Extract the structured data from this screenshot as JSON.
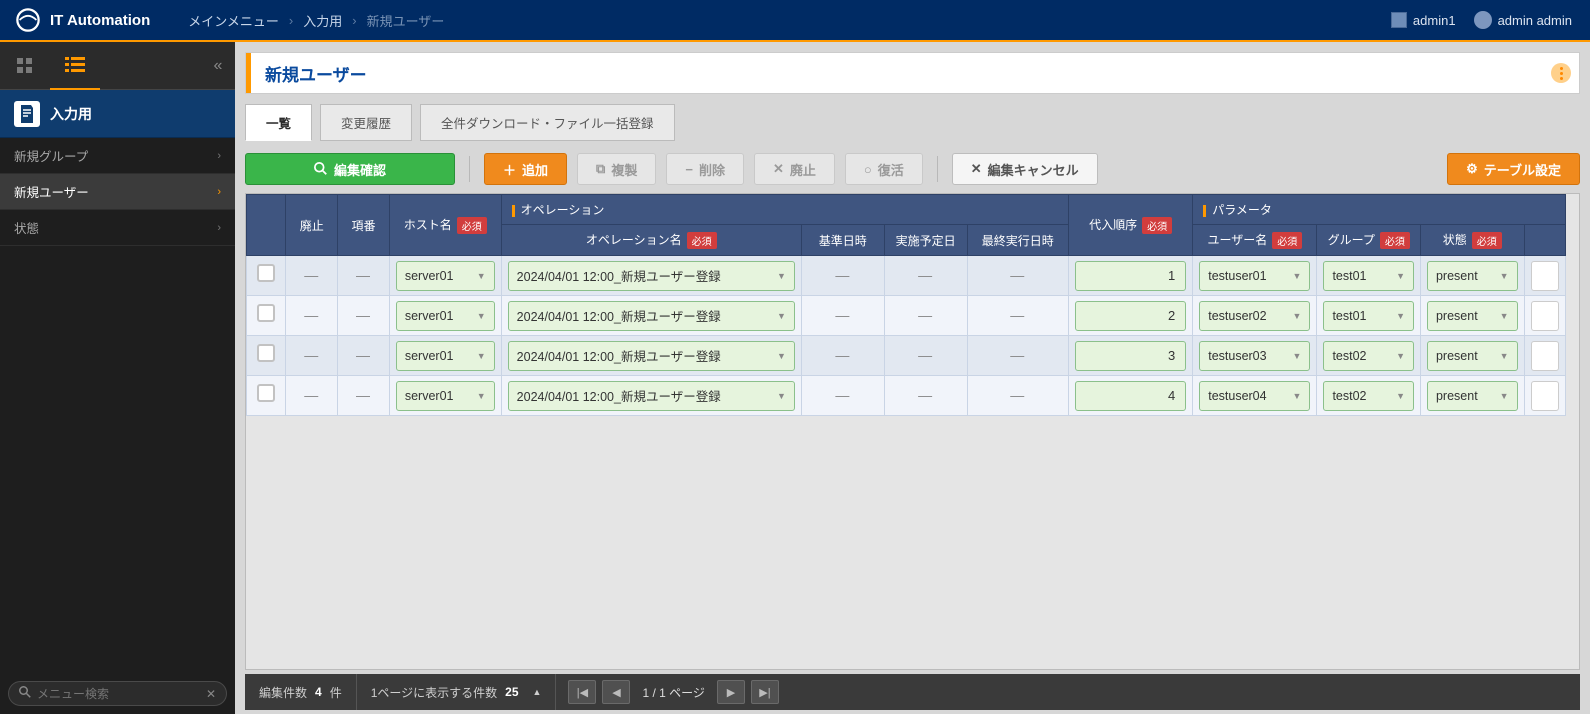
{
  "app": {
    "name": "IT Automation"
  },
  "breadcrumb": {
    "a": "メインメニュー",
    "b": "入力用",
    "c": "新規ユーザー"
  },
  "user": {
    "workspace": "admin1",
    "name": "admin admin"
  },
  "sidebar": {
    "section": "入力用",
    "items": [
      {
        "label": "新規グループ",
        "active": false
      },
      {
        "label": "新規ユーザー",
        "active": true
      },
      {
        "label": "状態",
        "active": false
      }
    ],
    "search_placeholder": "メニュー検索"
  },
  "page": {
    "title": "新規ユーザー"
  },
  "tabs": [
    {
      "label": "一覧",
      "active": true
    },
    {
      "label": "変更履歴",
      "active": false
    },
    {
      "label": "全件ダウンロード・ファイル一括登録",
      "active": false
    }
  ],
  "toolbar": {
    "confirm": "編集確認",
    "add": "追加",
    "copy": "複製",
    "delete": "削除",
    "discard": "廃止",
    "restore": "復活",
    "cancel": "編集キャンセル",
    "table_settings": "テーブル設定"
  },
  "columns": {
    "discard": "廃止",
    "no": "項番",
    "host": "ホスト名",
    "op_cat": "オペレーション",
    "op_name": "オペレーション名",
    "base_dt": "基準日時",
    "sched_dt": "実施予定日",
    "last_dt": "最終実行日時",
    "order": "代入順序",
    "param_cat": "パラメータ",
    "user": "ユーザー名",
    "group": "グループ",
    "state": "状態",
    "required": "必須"
  },
  "rows": [
    {
      "host": "server01",
      "op": "2024/04/01 12:00_新規ユーザー登録",
      "order": "1",
      "user": "testuser01",
      "group": "test01",
      "state": "present"
    },
    {
      "host": "server01",
      "op": "2024/04/01 12:00_新規ユーザー登録",
      "order": "2",
      "user": "testuser02",
      "group": "test01",
      "state": "present"
    },
    {
      "host": "server01",
      "op": "2024/04/01 12:00_新規ユーザー登録",
      "order": "3",
      "user": "testuser03",
      "group": "test02",
      "state": "present"
    },
    {
      "host": "server01",
      "op": "2024/04/01 12:00_新規ユーザー登録",
      "order": "4",
      "user": "testuser04",
      "group": "test02",
      "state": "present"
    }
  ],
  "footer": {
    "edit_label": "編集件数",
    "edit_count": "4",
    "edit_unit": "件",
    "per_page_label": "1ページに表示する件数",
    "per_page": "25",
    "page_cur": "1",
    "page_total": "1",
    "page_unit": "ページ"
  }
}
